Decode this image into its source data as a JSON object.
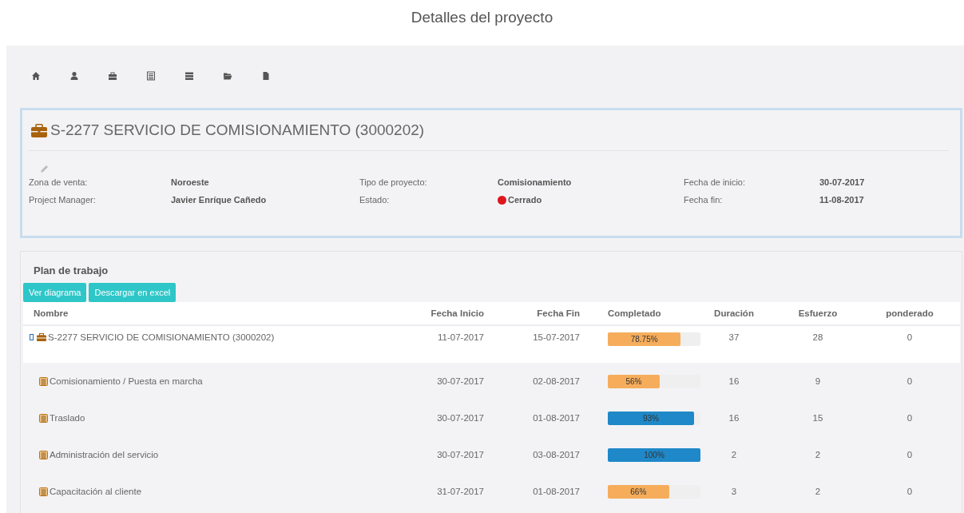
{
  "page_title": "Detalles del proyecto",
  "toolbar": [
    {
      "kind": "home"
    },
    {
      "kind": "user"
    },
    {
      "kind": "briefcase"
    },
    {
      "kind": "list"
    },
    {
      "kind": "server"
    },
    {
      "kind": "folder"
    },
    {
      "kind": "file"
    }
  ],
  "project": {
    "title": "S-2277 SERVICIO DE COMISIONAMIENTO (3000202)",
    "fields": [
      {
        "label": "Zona de venta:",
        "value": "Noroeste"
      },
      {
        "label": "Tipo de proyecto:",
        "value": "Comisionamiento"
      },
      {
        "label": "Fecha de inicio:",
        "value": "30-07-2017"
      },
      {
        "label": "Project Manager:",
        "value": "Javier Enríque Cañedo"
      },
      {
        "label": "Estado:",
        "value": "Cerrado",
        "color": "#e0161c"
      },
      {
        "label": "Fecha fin:",
        "value": "11-08-2017"
      }
    ]
  },
  "plan": {
    "title": "Plan de trabajo",
    "buttons": [
      "Ver diagrama",
      "Descargar en excel"
    ],
    "columns": [
      "Nombre",
      "Fecha Inicio",
      "Fecha Fin",
      "Completado",
      "Duración",
      "Esfuerzo",
      "ponderado"
    ],
    "rows": [
      {
        "kind": "project",
        "expanded": true,
        "name": "S-2277 SERVICIO DE COMISIONAMIENTO (3000202)",
        "start": "11-07-2017",
        "end": "15-07-2017",
        "level": 0.7875,
        "reading": "78.75%",
        "color": "#f6ad5b",
        "duration": "37",
        "effort": "28",
        "weight": "0",
        "children": [
          {
            "kind": "task",
            "name": "Comisionamiento / Puesta en marcha",
            "start": "30-07-2017",
            "end": "02-08-2017",
            "level": 0.56,
            "reading": "56%",
            "color": "#f6ad5b",
            "duration": "16",
            "effort": "9",
            "weight": "0"
          },
          {
            "kind": "task",
            "name": "Traslado",
            "start": "30-07-2017",
            "end": "01-08-2017",
            "level": 0.93,
            "reading": "93%",
            "color": "#1e88c8",
            "duration": "16",
            "effort": "15",
            "weight": "0"
          },
          {
            "kind": "task",
            "name": "Administración del servicio",
            "start": "30-07-2017",
            "end": "03-08-2017",
            "level": 1,
            "reading": "100%",
            "color": "#1e88c8",
            "duration": "2",
            "effort": "2",
            "weight": "0"
          },
          {
            "kind": "task",
            "name": "Capacitación al cliente",
            "start": "31-07-2017",
            "end": "01-08-2017",
            "level": 0.66,
            "reading": "66%",
            "color": "#f6ad5b",
            "duration": "3",
            "effort": "2",
            "weight": "0"
          }
        ]
      }
    ]
  }
}
